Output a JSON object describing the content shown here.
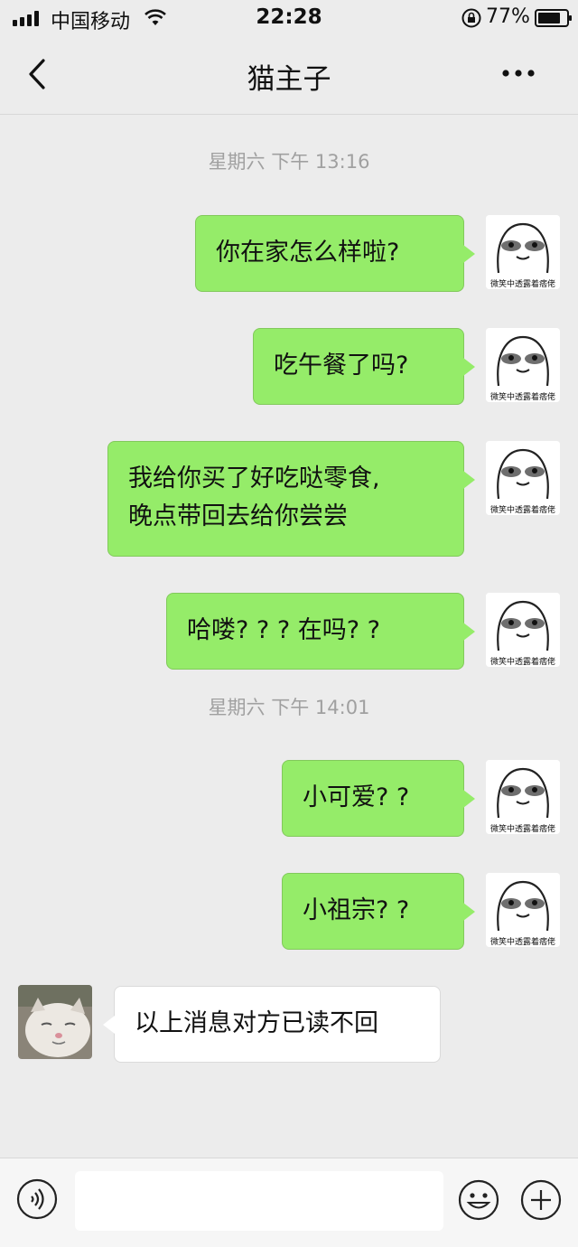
{
  "status_bar": {
    "carrier": "中国移动",
    "time": "22:28",
    "battery_percent": "77%"
  },
  "nav": {
    "title": "猫主子"
  },
  "timestamps": [
    "星期六 下午 13:16",
    "星期六 下午 14:01"
  ],
  "sticker_caption": "微笑中透露着痞佬",
  "messages": [
    {
      "side": "out",
      "lines": [
        "你在家怎么样啦?"
      ]
    },
    {
      "side": "out",
      "lines": [
        "吃午餐了吗?"
      ]
    },
    {
      "side": "out",
      "lines": [
        "我给你买了好吃哒零食,",
        "晚点带回去给你尝尝"
      ]
    },
    {
      "side": "out",
      "lines": [
        "哈喽? ? ? 在吗? ?"
      ]
    },
    {
      "side": "out",
      "lines": [
        "小可爱? ?"
      ]
    },
    {
      "side": "out",
      "lines": [
        "小祖宗? ?"
      ]
    },
    {
      "side": "in",
      "lines": [
        "以上消息对方已读不回"
      ]
    }
  ],
  "composer": {
    "placeholder": ""
  },
  "colors": {
    "outgoing_bubble": "#95ec69",
    "incoming_bubble": "#ffffff",
    "background": "#ececec"
  },
  "icons": [
    "signal-icon",
    "wifi-icon",
    "lock-icon",
    "battery-icon",
    "back-icon",
    "more-icon",
    "voice-icon",
    "emoji-icon",
    "plus-icon"
  ]
}
